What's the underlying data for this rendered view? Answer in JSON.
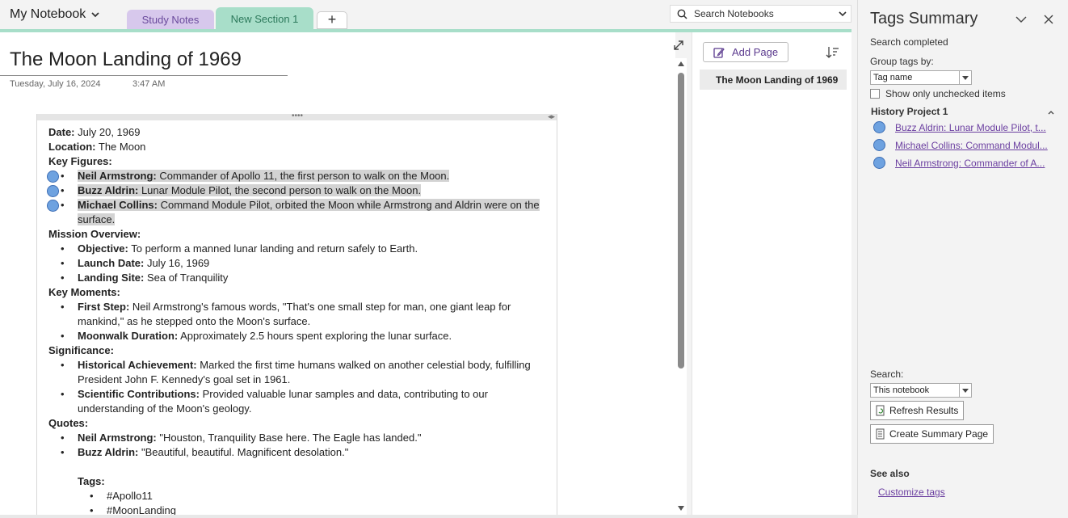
{
  "header": {
    "notebook_name": "My Notebook",
    "sections": [
      {
        "label": "Study Notes",
        "color": "#d7c8ec"
      },
      {
        "label": "New Section 1",
        "color": "#a8dec9"
      }
    ],
    "add_section_label": "+",
    "search_placeholder": "Search Notebooks"
  },
  "page": {
    "title": "The Moon Landing of 1969",
    "date": "Tuesday, July 16, 2024",
    "time": "3:47 AM",
    "note": {
      "date_label": "Date:",
      "date_value": " July 20, 1969",
      "location_label": "Location:",
      "location_value": " The Moon",
      "key_figures_heading": "Key Figures:",
      "key_figures": [
        {
          "name": "Neil Armstrong:",
          "text": " Commander of Apollo 11, the first person to walk on the Moon."
        },
        {
          "name": "Buzz Aldrin:",
          "text": " Lunar Module Pilot, the second person to walk on the Moon."
        },
        {
          "name": "Michael Collins:",
          "text": " Command Module Pilot, orbited the Moon while Armstrong and Aldrin were on the surface."
        }
      ],
      "mission_heading": "Mission Overview:",
      "mission": [
        {
          "label": "Objective:",
          "text": " To perform a manned lunar landing and return safely to Earth."
        },
        {
          "label": "Launch Date:",
          "text": " July 16, 1969"
        },
        {
          "label": "Landing Site:",
          "text": " Sea of Tranquility"
        }
      ],
      "moments_heading": "Key Moments:",
      "moments": [
        {
          "label": "First Step:",
          "text": " Neil Armstrong's famous words, \"That's one small step for man, one giant leap for mankind,\" as he stepped onto the Moon's surface."
        },
        {
          "label": "Moonwalk Duration:",
          "text": " Approximately 2.5 hours spent exploring the lunar surface."
        }
      ],
      "significance_heading": "Significance:",
      "significance": [
        {
          "label": "Historical Achievement:",
          "text": " Marked the first time humans walked on another celestial body, fulfilling President John F. Kennedy's goal set in 1961."
        },
        {
          "label": "Scientific Contributions:",
          "text": " Provided valuable lunar samples and data, contributing to our understanding of the Moon's geology."
        }
      ],
      "quotes_heading": "Quotes:",
      "quotes": [
        {
          "label": "Neil Armstrong:",
          "text": " \"Houston, Tranquility Base here. The Eagle has landed.\""
        },
        {
          "label": "Buzz Aldrin:",
          "text": " \"Beautiful, beautiful. Magnificent desolation.\""
        }
      ],
      "tags_heading": "Tags:",
      "tags": [
        "#Apollo11",
        "#MoonLanding"
      ]
    }
  },
  "page_list": {
    "add_page_label": "Add Page",
    "pages": [
      "The Moon Landing of 1969"
    ]
  },
  "tags_summary": {
    "title": "Tags Summary",
    "status": "Search completed",
    "group_by_label": "Group tags by:",
    "group_by_value": "Tag name",
    "unchecked_label": "Show only unchecked items",
    "group_name": "History Project 1",
    "results": [
      "Buzz Aldrin: Lunar Module Pilot, t...",
      "Michael Collins: Command Modul...",
      "Neil Armstrong: Commander of A..."
    ],
    "search_label": "Search:",
    "search_scope": "This notebook",
    "refresh_label": "Refresh Results",
    "create_summary_label": "Create Summary Page",
    "see_also_label": "See also",
    "customize_label": "Customize tags"
  },
  "colors": {
    "tag_fill": "#6ea2e0",
    "link": "#6b3fa0",
    "section_active": "#a8dec9"
  }
}
